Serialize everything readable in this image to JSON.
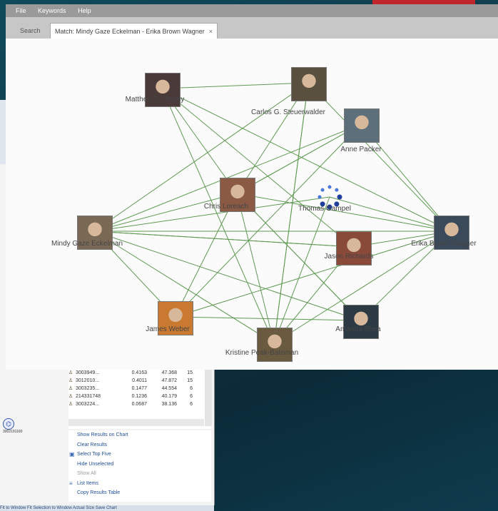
{
  "window": {
    "menu": [
      "File",
      "Keywords",
      "Help"
    ],
    "tabs": [
      {
        "label": "Search"
      },
      {
        "label": "Match: Mindy Gaze Eckelman - Erika Brown Wagner",
        "close": "×"
      }
    ]
  },
  "graph": {
    "people": [
      {
        "name": "Matthew P. Healey",
        "photo_color": "#4a3a3a"
      },
      {
        "name": "Carlos G. Steuerwalder",
        "photo_color": "#5a5040"
      },
      {
        "name": "Anne Packer",
        "photo_color": "#5d6f7a"
      },
      {
        "name": "Chris Loreach",
        "photo_color": "#8a5a45"
      },
      {
        "name": "Thomas Gampel",
        "photo_color": "#2b54b0"
      },
      {
        "name": "Mindy Gaze Eckelman",
        "photo_color": "#7a6a55"
      },
      {
        "name": "Erika Brown Wagner",
        "photo_color": "#3a4a5a"
      },
      {
        "name": "Jason Richards",
        "photo_color": "#8a4a3a"
      },
      {
        "name": "James Weber",
        "photo_color": "#c97a30"
      },
      {
        "name": "Amanda Shea",
        "photo_color": "#2c3a44"
      },
      {
        "name": "Kristine Peak-Bateman",
        "photo_color": "#6a5a40"
      }
    ],
    "edge_color": "#5e9a52"
  },
  "results": {
    "rows": [
      [
        "3003949...",
        "0.4163",
        "47.368",
        "15"
      ],
      [
        "3012010...",
        "0.4011",
        "47.872",
        "15"
      ],
      [
        "3003235...",
        "0.1477",
        "44.554",
        "6"
      ],
      [
        "214331748",
        "0.1236",
        "40.179",
        "6"
      ],
      [
        "3003224...",
        "0.0687",
        "38.136",
        "6"
      ]
    ],
    "actions": [
      {
        "label": "Show Results on Chart",
        "disabled": false,
        "icon": ""
      },
      {
        "label": "Clear Results",
        "disabled": false,
        "icon": ""
      },
      {
        "label": "Select Top Five",
        "disabled": false,
        "icon": "select-icon"
      },
      {
        "label": "Hide Unselected",
        "disabled": false,
        "icon": ""
      },
      {
        "label": "Show All",
        "disabled": true,
        "icon": ""
      },
      {
        "label": "List Items",
        "disabled": false,
        "icon": "list-icon"
      },
      {
        "label": "Copy Results Table",
        "disabled": false,
        "icon": ""
      }
    ],
    "node_id": "3002191160",
    "status": "Fit to Window   Fit Selection to Window   Actual Size   Save Chart"
  },
  "colors": {
    "accent": "#c0262b",
    "link": "#1f4f9a"
  }
}
